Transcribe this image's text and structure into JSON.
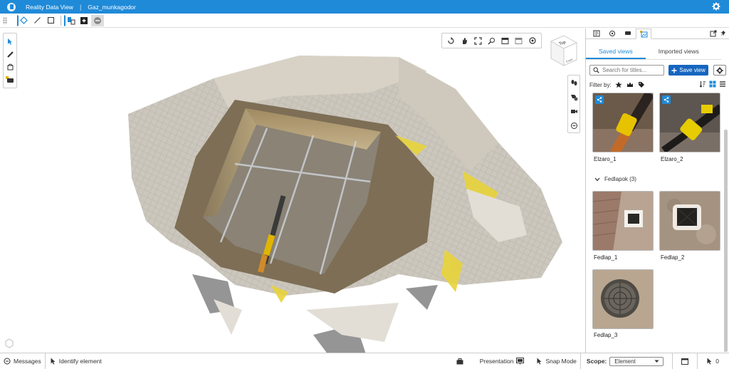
{
  "app": {
    "title": "Reality Data View",
    "separator": "|",
    "project": "Gaz_munkagodor"
  },
  "view_cube": {
    "top": "Top",
    "front": "Front"
  },
  "panel": {
    "subtabs": [
      "Saved views",
      "Imported views"
    ],
    "search_placeholder": "Search for titles...",
    "save_button": "Save view",
    "filter_label": "Filter by:",
    "views": [
      {
        "label": "Elzaro_1"
      },
      {
        "label": "Elzaro_2"
      }
    ],
    "group": {
      "label": "Fedlapok (3)"
    },
    "group_views": [
      {
        "label": "Fedlap_1"
      },
      {
        "label": "Fedlap_2"
      },
      {
        "label": "Fedlap_3"
      }
    ]
  },
  "status": {
    "messages": "Messages",
    "identify": "Identify element",
    "presentation": "Presentation",
    "snap_mode": "Snap Mode",
    "scope_label": "Scope:",
    "scope_value": "Element",
    "selection_count": "0"
  },
  "colors": {
    "accent": "#1f8ad8",
    "button": "#1565c0"
  }
}
